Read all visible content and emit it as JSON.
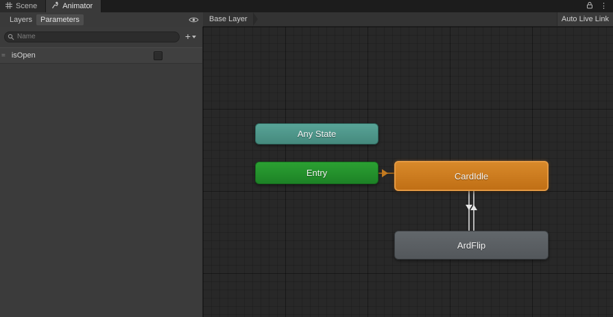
{
  "icons": {
    "kebab": "⋮",
    "drag_handle": "="
  },
  "titlebar": {
    "scene_tab": "Scene",
    "animator_tab": "Animator"
  },
  "left_panel": {
    "layers_tab": "Layers",
    "parameters_tab": "Parameters",
    "search_placeholder": "Name",
    "add_button": "+",
    "parameters": [
      {
        "name": "isOpen",
        "checked": false
      }
    ]
  },
  "canvas": {
    "breadcrumb": "Base Layer",
    "auto_live_link": "Auto Live Link",
    "nodes": [
      {
        "label": "Any State",
        "color": "#4e9a8c"
      },
      {
        "label": "Entry",
        "color": "#27962e"
      },
      {
        "label": "CardIdle",
        "color": "#cc7a1e",
        "selected": true
      },
      {
        "label": "ArdFlip",
        "color": "#5c6165"
      }
    ],
    "transitions": [
      {
        "from": "Entry",
        "to": "CardIdle"
      },
      {
        "from": "CardIdle",
        "to": "ArdFlip"
      },
      {
        "from": "ArdFlip",
        "to": "CardIdle"
      }
    ]
  }
}
